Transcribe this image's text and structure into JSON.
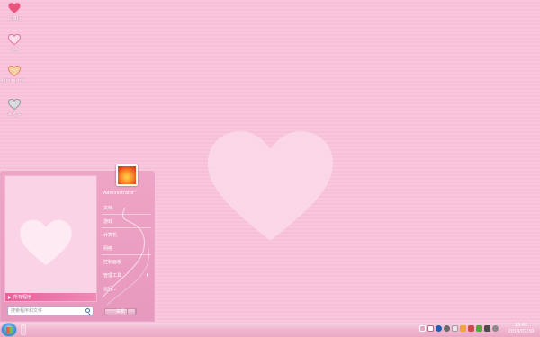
{
  "desktop": {
    "icons": [
      {
        "label": "计算机",
        "icon": "computer-heart-icon"
      },
      {
        "label": "网络",
        "icon": "network-heart-icon"
      },
      {
        "label": "Administra...",
        "icon": "user-folder-heart-icon"
      },
      {
        "label": "回收站",
        "icon": "recycle-bin-heart-icon"
      }
    ]
  },
  "start_menu": {
    "all_programs": "所有程序",
    "search_placeholder": "搜索程序和文件",
    "right_items": [
      {
        "label": "Administrator"
      },
      {
        "label": "文档"
      },
      {
        "label": "游戏"
      },
      {
        "label": "计算机"
      },
      {
        "label": "网络"
      },
      {
        "label": "控制面板"
      },
      {
        "label": "管理工具"
      },
      {
        "label": "运行..."
      }
    ],
    "shutdown_label": "关机"
  },
  "taskbar": {
    "time": "13:41",
    "date": "2014/07/30"
  },
  "colors": {
    "desktop_bg": "#f8c5dc",
    "accent": "#e8609a",
    "heart": "#fbdce9"
  }
}
